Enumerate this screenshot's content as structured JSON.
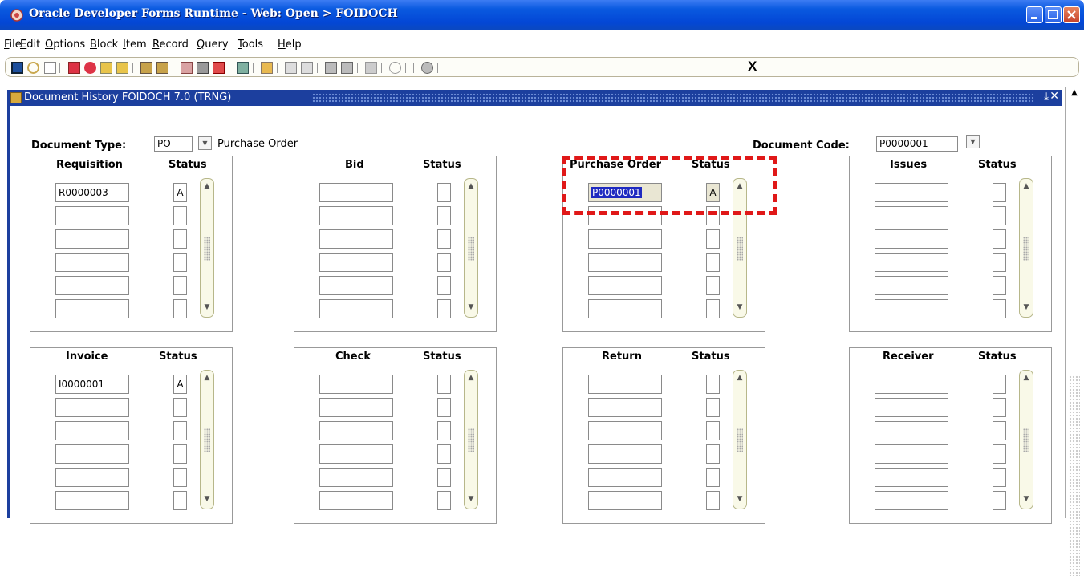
{
  "window": {
    "title": "Oracle Developer Forms Runtime - Web:  Open > FOIDOCH"
  },
  "menu": [
    {
      "pre": "",
      "u": "F",
      "post": "ile"
    },
    {
      "pre": "",
      "u": "E",
      "post": "dit"
    },
    {
      "pre": "",
      "u": "O",
      "post": "ptions"
    },
    {
      "pre": "",
      "u": "B",
      "post": "lock"
    },
    {
      "pre": "",
      "u": "I",
      "post": "tem"
    },
    {
      "pre": "",
      "u": "R",
      "post": "ecord"
    },
    {
      "pre": "",
      "u": "Q",
      "post": "uery"
    },
    {
      "pre": "",
      "u": "T",
      "post": "ools"
    },
    {
      "pre": "",
      "u": "H",
      "post": "elp"
    }
  ],
  "toolbar": {
    "exit_label": "X"
  },
  "form": {
    "title": "Document History  FOIDOCH  7.0  (TRNG)",
    "document_type_label": "Document Type:",
    "document_type_value": "PO",
    "document_type_desc": "Purchase Order",
    "document_code_label": "Document Code:",
    "document_code_value": "P0000001"
  },
  "panels": {
    "requisition": {
      "title": "Requisition",
      "status_title": "Status",
      "code": "R0000003",
      "status": "A"
    },
    "bid": {
      "title": "Bid",
      "status_title": "Status",
      "code": "",
      "status": ""
    },
    "purchase_order": {
      "title": "Purchase Order",
      "status_title": "Status",
      "code": "P0000001",
      "status": "A"
    },
    "issues": {
      "title": "Issues",
      "status_title": "Status",
      "code": "",
      "status": ""
    },
    "invoice": {
      "title": "Invoice",
      "status_title": "Status",
      "code": "I0000001",
      "status": "A"
    },
    "check": {
      "title": "Check",
      "status_title": "Status",
      "code": "",
      "status": ""
    },
    "return": {
      "title": "Return",
      "status_title": "Status",
      "code": "",
      "status": ""
    },
    "receiver": {
      "title": "Receiver",
      "status_title": "Status",
      "code": "",
      "status": ""
    }
  },
  "colors": {
    "titlebar": "#0a5ae0",
    "inner_titlebar": "#1c3f9e",
    "highlight": "#e01818",
    "selection": "#1f2ac0"
  }
}
